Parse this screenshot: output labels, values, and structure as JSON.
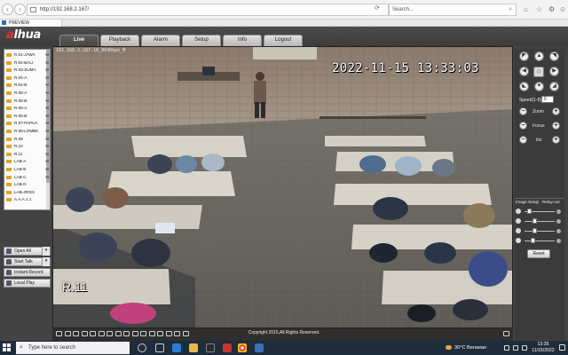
{
  "browser": {
    "url": "http://192.168.2.167/",
    "search_placeholder": "Search...",
    "tab_title": "PREVIEW"
  },
  "app": {
    "logo": "alhua",
    "nav_tabs": [
      "Live",
      "Playback",
      "Alarm",
      "Setup",
      "Info",
      "Logout"
    ],
    "active_tab": "Live",
    "channels": [
      "R.01-JAWA",
      "R.02-BALI",
      "R.03-SUMA",
      "R.04-A",
      "R.04-B",
      "R.05-A",
      "R.05-B",
      "R.06-A",
      "R.06-B",
      "R.07-PAPUA",
      "R.08-LOMBK",
      "R.09",
      "R.10",
      "R.11",
      "LAB-A",
      "LAB-B",
      "LAB-C",
      "LAB-D",
      "LAB-JRGN",
      "A.A.A.1.1"
    ],
    "channel_cap": "M",
    "buttons": {
      "open_all": "Open All",
      "start_talk": "Start Talk",
      "instant_record": "Instant Record",
      "local_play": "Local Play"
    },
    "video": {
      "title": "192.168.2.167-16_904Kbps_M",
      "timestamp": "2022-11-15  13:33:03",
      "label": "R.11"
    },
    "ptz": {
      "speed_label": "Speed(1-8):",
      "speed_value": "5",
      "zoom": "Zoom",
      "focus": "Focus",
      "iris": "Iris"
    },
    "image_setup": {
      "tab_image": "Image Setup",
      "tab_relay": "Relay-out",
      "reset": "Reset"
    },
    "footer": "Copyright 2015,All Rights Reserved."
  },
  "taskbar": {
    "search_placeholder": "Type here to search",
    "weather": "30°C  Berawan",
    "time": "13:35",
    "date": "11/15/2022"
  }
}
